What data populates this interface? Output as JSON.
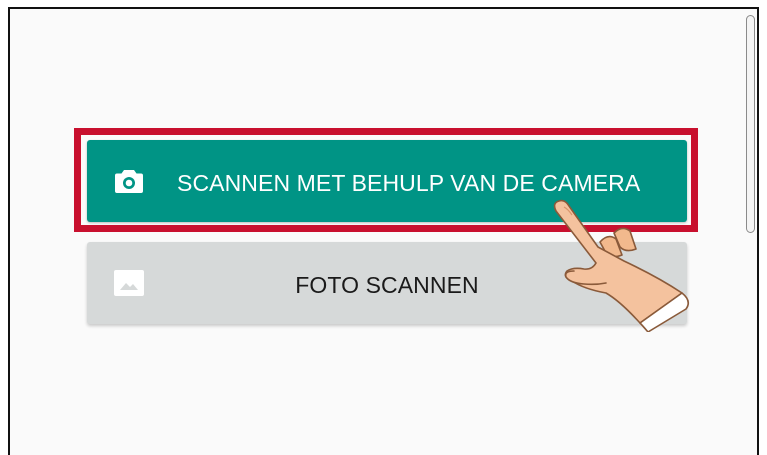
{
  "buttons": {
    "scan_camera": {
      "label": "SCANNEN MET BEHULP VAN DE CAMERA",
      "icon": "camera-icon",
      "background": "#009485",
      "highlighted": true,
      "highlight_color": "#c8102e"
    },
    "scan_photo": {
      "label": "FOTO SCANNEN",
      "icon": "image-icon",
      "background": "#d6d9d9"
    }
  },
  "overlay": {
    "pointer": "pointing-hand-icon"
  }
}
